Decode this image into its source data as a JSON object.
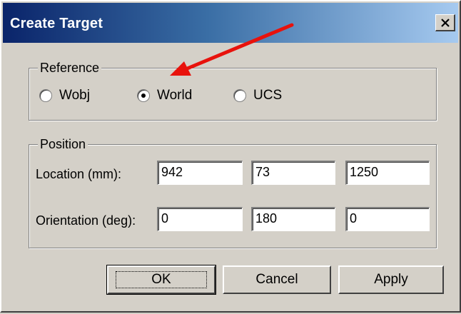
{
  "window": {
    "title": "Create Target",
    "close_glyph": "×"
  },
  "reference": {
    "label": "Reference",
    "options": [
      {
        "label": "Wobj",
        "selected": false
      },
      {
        "label": "World",
        "selected": true
      },
      {
        "label": "UCS",
        "selected": false
      }
    ]
  },
  "position": {
    "label": "Position",
    "location_label": "Location (mm):",
    "location": [
      "942",
      "73",
      "1250"
    ],
    "orientation_label": "Orientation (deg):",
    "orientation": [
      "0",
      "180",
      "0"
    ]
  },
  "buttons": {
    "ok": "OK",
    "cancel": "Cancel",
    "apply": "Apply"
  },
  "annotation": {
    "arrow_color": "#e8120c",
    "points_to": "World"
  }
}
